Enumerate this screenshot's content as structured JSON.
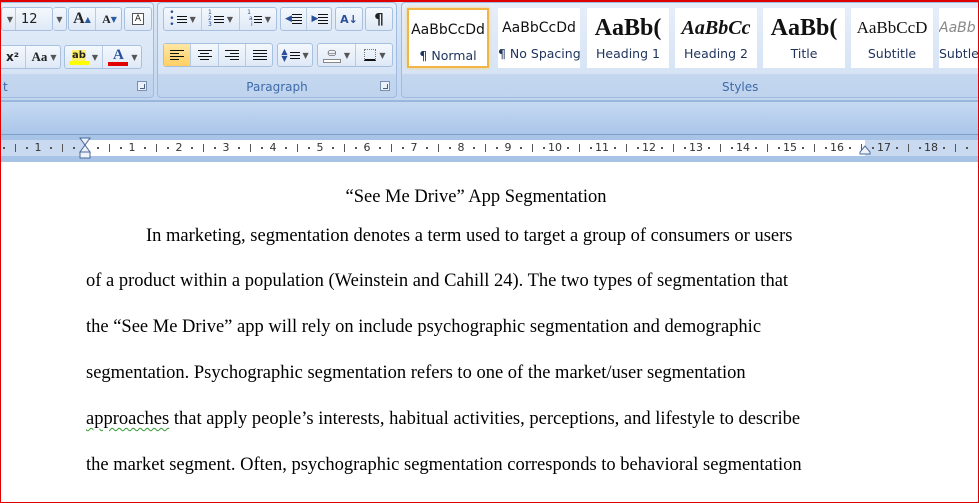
{
  "ribbon": {
    "font_group": {
      "label": "Font",
      "font_size": "12",
      "grow_font": "A",
      "shrink_font": "A",
      "clear_format": "A",
      "superscript": "x²",
      "change_case": "Aa",
      "highlight": "ab",
      "highlight_color": "#ffff00",
      "font_color_glyph": "A",
      "font_color": "#e00000"
    },
    "paragraph_group": {
      "label": "Paragraph",
      "sort_glyph": "A↓",
      "show_marks_glyph": "¶"
    },
    "styles_group": {
      "label": "Styles",
      "items": [
        {
          "sample": "AaBbCcDd",
          "name": "¶ Normal",
          "selected": true
        },
        {
          "sample": "AaBbCcDd",
          "name": "¶ No Spacing"
        },
        {
          "sample": "AaBb(",
          "name": "Heading 1"
        },
        {
          "sample": "AaBbCc",
          "name": "Heading 2"
        },
        {
          "sample": "AaBb(",
          "name": "Title"
        },
        {
          "sample": "AaBbCcD",
          "name": "Subtitle"
        },
        {
          "sample": "AaBb",
          "name": "Subtle"
        }
      ]
    }
  },
  "ruler": {
    "left_labels": [
      "1"
    ],
    "labels": [
      "1",
      "2",
      "3",
      "4",
      "5",
      "6",
      "7",
      "8",
      "9",
      "10",
      "11",
      "12",
      "13",
      "14",
      "15",
      "16",
      "17",
      "18"
    ]
  },
  "document": {
    "title": "“See Me Drive” App Segmentation",
    "lines": [
      "In marketing, segmentation denotes a term used to target a group of consumers or users",
      "of a product within a population (Weinstein and Cahill 24). The two types of segmentation that",
      "the “See Me Drive” app will rely on include psychographic segmentation and demographic",
      "segmentation. Psychographic segmentation refers to one of the market/user segmentation",
      "that apply people’s interests, habitual activities, perceptions, and lifestyle to describe",
      "the market segment. Often, psychographic segmentation corresponds to behavioral segmentation"
    ],
    "misspelled_word": "approaches"
  }
}
